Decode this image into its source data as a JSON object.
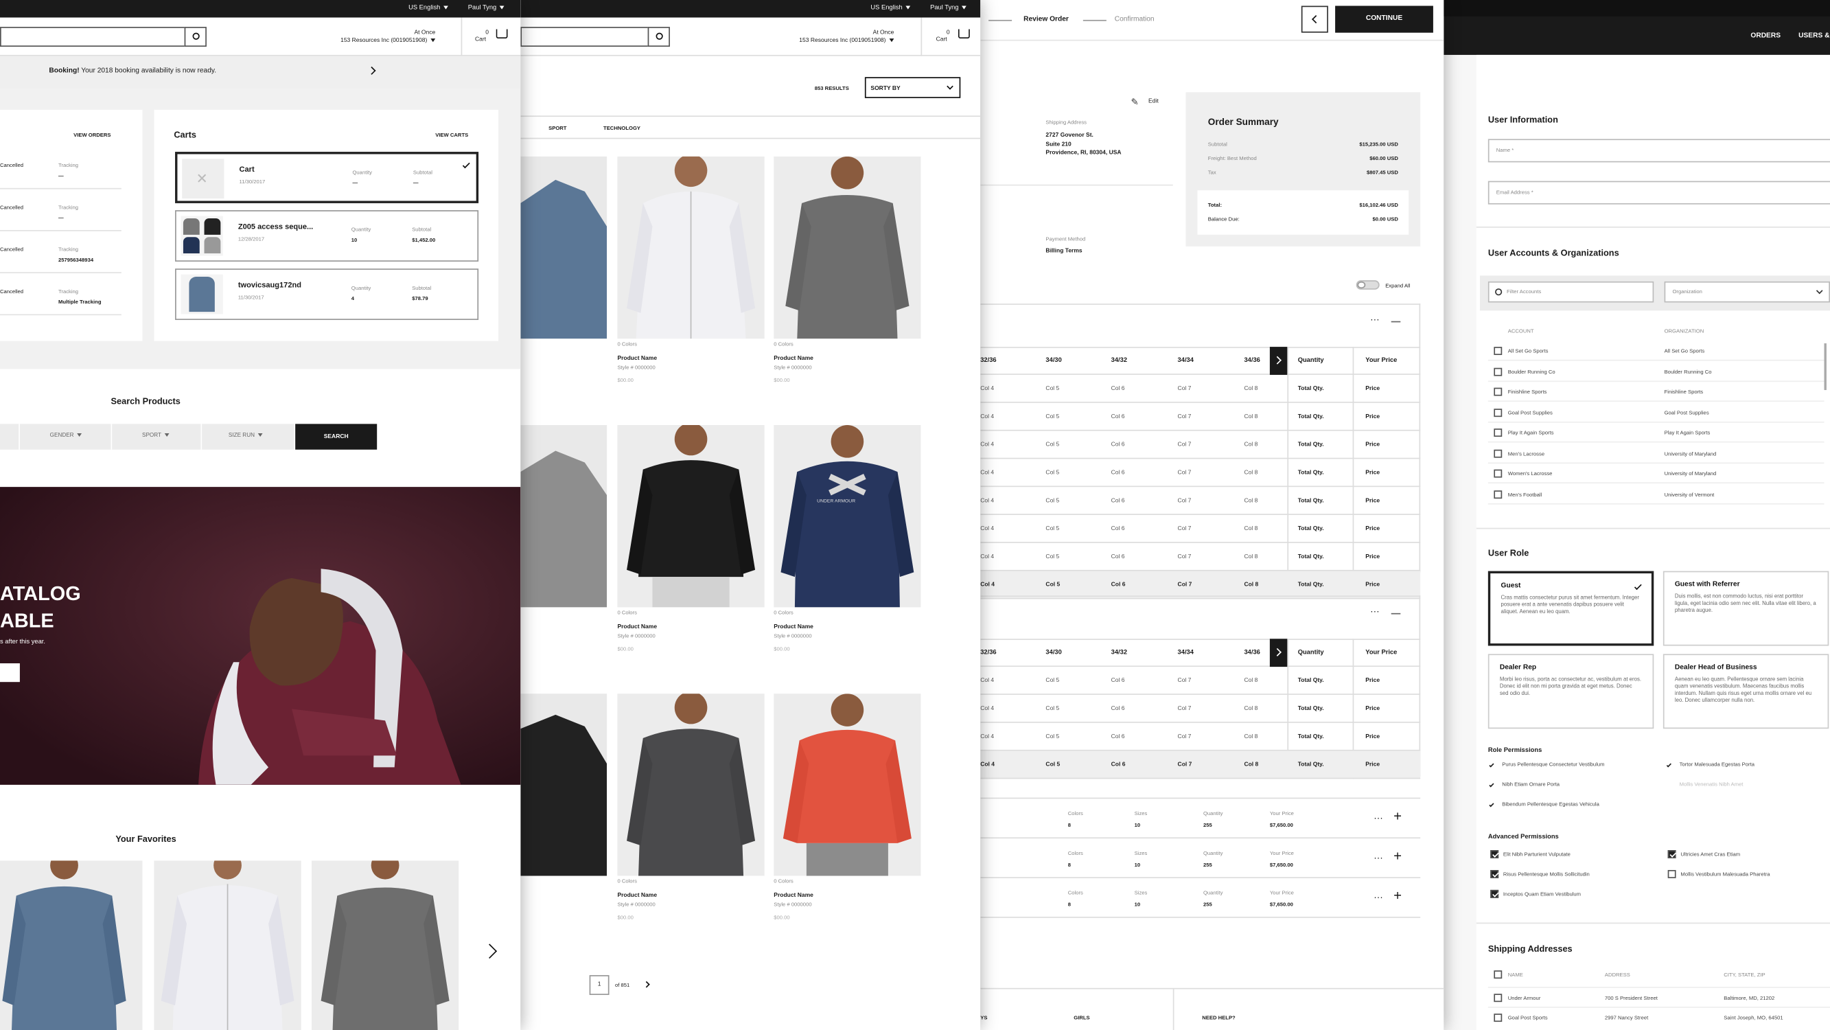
{
  "p1": {
    "lang": "US English",
    "user": "Paul Tyng",
    "account_at": "At Once",
    "account_name": "153 Resources Inc (0019051908)",
    "cart_count": "0",
    "cart_label": "Cart",
    "banner_bold": "Booking!",
    "banner_text": " Your 2018 booking availability is now ready.",
    "orders_link": "VIEW ORDERS",
    "orders": [
      {
        "status": "Cancelled",
        "tracking_label": "Tracking",
        "tracking": "—"
      },
      {
        "status": "Cancelled",
        "tracking_label": "Tracking",
        "tracking": "—"
      },
      {
        "status": "Cancelled",
        "tracking_label": "Tracking",
        "tracking": "257956348934"
      },
      {
        "status": "Cancelled",
        "tracking_label": "Tracking",
        "tracking": "Multiple Tracking"
      }
    ],
    "carts_title": "Carts",
    "carts_link": "VIEW CARTS",
    "carts": [
      {
        "name": "Cart",
        "date": "11/30/2017",
        "qty_label": "Quantity",
        "qty": "—",
        "sub_label": "Subtotal",
        "sub": "—"
      },
      {
        "name": "Z005 access seque...",
        "date": "12/28/2017",
        "qty_label": "Quantity",
        "qty": "10",
        "sub_label": "Subtotal",
        "sub": "$1,452.00"
      },
      {
        "name": "twovicsaug172nd",
        "date": "11/30/2017",
        "qty_label": "Quantity",
        "qty": "4",
        "sub_label": "Subtotal",
        "sub": "$78.79"
      }
    ],
    "search_title": "Search Products",
    "filters": [
      "GENDER",
      "SPORT",
      "SIZE RUN"
    ],
    "search_btn": "SEARCH",
    "hero_line1": "ATALOG",
    "hero_line2": "ABLE",
    "hero_sub": "s after this year.",
    "favorites_title": "Your Favorites"
  },
  "p2": {
    "lang": "US English",
    "user": "Paul Tyng",
    "account_at": "At Once",
    "account_name": "153 Resources Inc (0019051908)",
    "cart_count": "0",
    "cart_label": "Cart",
    "results": "853 RESULTS",
    "sort": "SORTY BY",
    "tabs": [
      "SPORT",
      "TECHNOLOGY"
    ],
    "products": [
      {
        "colors": "0 Colors",
        "name": "Product Name",
        "style": "Style # 0000000",
        "price": "$00.00"
      },
      {
        "colors": "0 Colors",
        "name": "Product Name",
        "style": "Style # 0000000",
        "price": "$00.00"
      },
      {
        "colors": "0 Colors",
        "name": "Product Name",
        "style": "Style # 0000000",
        "price": "$00.00"
      },
      {
        "colors": "0 Colors",
        "name": "Product Name",
        "style": "Style # 0000000",
        "price": "$00.00"
      },
      {
        "colors": "0 Colors",
        "name": "Product Name",
        "style": "Style # 0000000",
        "price": "$00.00"
      },
      {
        "colors": "0 Colors",
        "name": "Product Name",
        "style": "Style # 0000000",
        "price": "$00.00"
      }
    ],
    "page_current": "1",
    "page_total": "of 851",
    "logo_text": "UNDER ARMOUR"
  },
  "p3": {
    "step_review": "Review Order",
    "step_confirm": "Confirmation",
    "continue": "CONTINUE",
    "edit": "Edit",
    "ship_label": "Shipping Address",
    "ship_lines": [
      "2727 Govenor St.",
      "Suite 210",
      "Providence, RI, 80304, USA"
    ],
    "payment_label": "Payment Method",
    "billing_label": "Billing Terms",
    "summary_title": "Order Summary",
    "summary": [
      {
        "k": "Subtotal",
        "v": "$15,235.00 USD"
      },
      {
        "k": "Freight: Best Method",
        "v": "$60.00 USD"
      },
      {
        "k": "Tax",
        "v": "$807.45 USD"
      }
    ],
    "total_k": "Total:",
    "total_v": "$16,102.46 USD",
    "balance_k": "Balance Due:",
    "balance_v": "$0.00 USD",
    "expand": "Expand All",
    "size_headers": [
      "32/36",
      "34/30",
      "34/32",
      "34/34",
      "34/36"
    ],
    "qty_header": "Quantity",
    "price_header": "Your Price",
    "row_cells": [
      "Col 4",
      "Col 5",
      "Col 6",
      "Col 7",
      "Col 8"
    ],
    "total_qty": "Total Qty.",
    "price": "Price",
    "line_items": [
      {
        "colors_l": "Colors",
        "colors": "8",
        "sizes_l": "Sizes",
        "sizes": "10",
        "qty_l": "Quantity",
        "qty": "255",
        "price_l": "Your Price",
        "price": "$7,650.00"
      },
      {
        "colors_l": "Colors",
        "colors": "8",
        "sizes_l": "Sizes",
        "sizes": "10",
        "qty_l": "Quantity",
        "qty": "255",
        "price_l": "Your Price",
        "price": "$7,650.00"
      },
      {
        "colors_l": "Colors",
        "colors": "8",
        "sizes_l": "Sizes",
        "sizes": "10",
        "qty_l": "Quantity",
        "qty": "255",
        "price_l": "Your Price",
        "price": "$7,650.00"
      }
    ],
    "footer_ys": "YS",
    "footer_girls": "GIRLS",
    "footer_help": "NEED HELP?"
  },
  "p4": {
    "nav": [
      "ORDERS",
      "USERS &"
    ],
    "user_info": "User Information",
    "name_ph": "Name *",
    "email_ph": "Email Address *",
    "accounts_title": "User Accounts & Organizations",
    "filter_ph": "Filter Accounts",
    "org_select": "Organization",
    "col_account": "ACCOUNT",
    "col_org": "ORGANIZATION",
    "accounts": [
      {
        "a": "All Set Go Sports",
        "o": "All Set Go Sports"
      },
      {
        "a": "Boulder Running Co",
        "o": "Boulder Running Co"
      },
      {
        "a": "Finishline Sports",
        "o": "Finishline Sports"
      },
      {
        "a": "Goal Post Supplies",
        "o": "Goal Post Supplies"
      },
      {
        "a": "Play It Again Sports",
        "o": "Play It Again Sports"
      },
      {
        "a": "Men's Lacrosse",
        "o": "University of Maryland"
      },
      {
        "a": "Women's Lacrosse",
        "o": "University of Maryland"
      },
      {
        "a": "Men's Football",
        "o": "University of Vermont"
      }
    ],
    "role_title": "User Role",
    "roles": [
      {
        "t": "Guest",
        "d": "Cras mattis consectetur purus sit amet fermentum. Integer posuere erat a ante venenatis dapibus posuere velit aliquet. Aenean eu leo quam."
      },
      {
        "t": "Guest with Referrer",
        "d": "Duis mollis, est non commodo luctus, nisi erat porttitor ligula, eget lacinia odio sem nec elit. Nulla vitae elit libero, a pharetra augue."
      },
      {
        "t": "Dealer Rep",
        "d": "Morbi leo risus, porta ac consectetur ac, vestibulum at eros. Donec id elit non mi porta gravida at eget metus. Donec sed odio dui."
      },
      {
        "t": "Dealer Head of Business",
        "d": "Aenean eu leo quam. Pellentesque ornare sem lacinia quam venenatis vestibulum. Maecenas faucibus mollis interdum. Nullam quis risus eget urna mollis ornare vel eu leo. Donec ullamcorper nulla non."
      }
    ],
    "perm_title": "Role Permissions",
    "perms": [
      "Purus Pellentesque Consectetur Vestibulum",
      "Nibh Etiam Ornare Porta",
      "Bibendum Pellentesque Egestas Vehicula",
      "Tortor Malesuada Egestas Porta",
      "Mollis Venenatis Nibh Amet"
    ],
    "adv_title": "Advanced Permissions",
    "adv": [
      "Elit Nibh Parturient Vulputate",
      "Risus Pellentesque Mollis Sollicitudin",
      "Inceptos Quam Etiam Vestibulum",
      "Ultricies Amet Cras Etiam",
      "Mollis Vestibulum Malesuada Pharetra"
    ],
    "ship_title": "Shipping Addresses",
    "ship_cols": [
      "NAME",
      "ADDRESS",
      "CITY, STATE, ZIP"
    ],
    "ship_rows": [
      {
        "n": "Under Armour",
        "a": "700 S President Street",
        "c": "Baltimore, MD, 21202"
      },
      {
        "n": "Goal Post Sports",
        "a": "2997 Nancy Street",
        "c": "Saint Joseph, MO, 64501"
      }
    ]
  },
  "colors": {
    "dark": "#1a1a1a",
    "hero_bg": "#3a1a24",
    "summary_bg": "#efefef",
    "accent_red": "#e2533f",
    "navy": "#23325a"
  }
}
